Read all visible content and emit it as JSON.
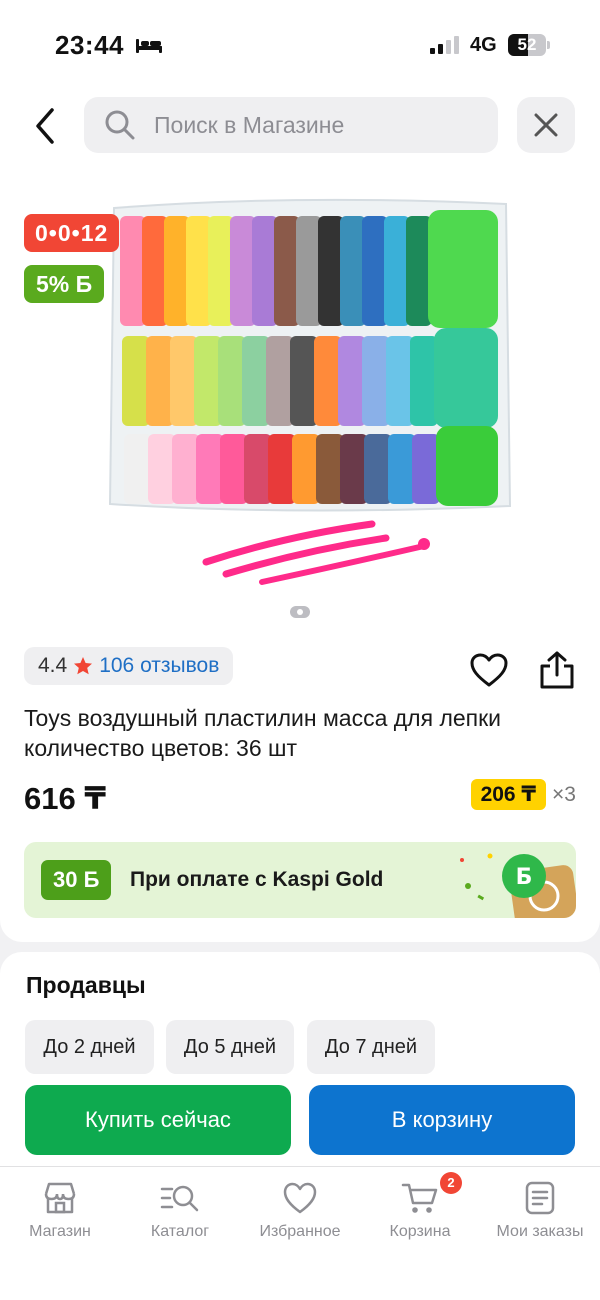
{
  "status_bar": {
    "time": "23:44",
    "network": "4G",
    "battery": "52"
  },
  "search": {
    "placeholder": "Поиск в Магазине"
  },
  "product": {
    "timer": "0•0•12",
    "bonus_badge": "5% Б",
    "rating": "4.4",
    "reviews": "106 отзывов",
    "title": "Toys воздушный пластилин масса для лепки количество цветов: 36 шт",
    "price": "616 ₸",
    "installment_amount": "206 ₸",
    "installment_times": "×3"
  },
  "kaspi_promo": {
    "bonus": "30 Б",
    "text": "При оплате с Kaspi Gold"
  },
  "sellers": {
    "title": "Продавцы",
    "delivery_options": [
      "До 2 дней",
      "До 5 дней",
      "До 7 дней"
    ]
  },
  "actions": {
    "buy_now": "Купить сейчас",
    "add_to_cart": "В корзину"
  },
  "nav": {
    "items": [
      {
        "label": "Магазин",
        "icon": "shop-icon"
      },
      {
        "label": "Каталог",
        "icon": "catalog-icon"
      },
      {
        "label": "Избранное",
        "icon": "heart-icon"
      },
      {
        "label": "Корзина",
        "icon": "cart-icon"
      },
      {
        "label": "Мои заказы",
        "icon": "orders-icon"
      }
    ],
    "cart_count": "2"
  },
  "colors": {
    "timer_red": "#f14635",
    "bonus_green": "#5aaa1e",
    "link_blue": "#1f6fc5",
    "installment_yellow": "#ffd200",
    "buy_green": "#0eaa4f",
    "cart_blue": "#0d74cf"
  }
}
